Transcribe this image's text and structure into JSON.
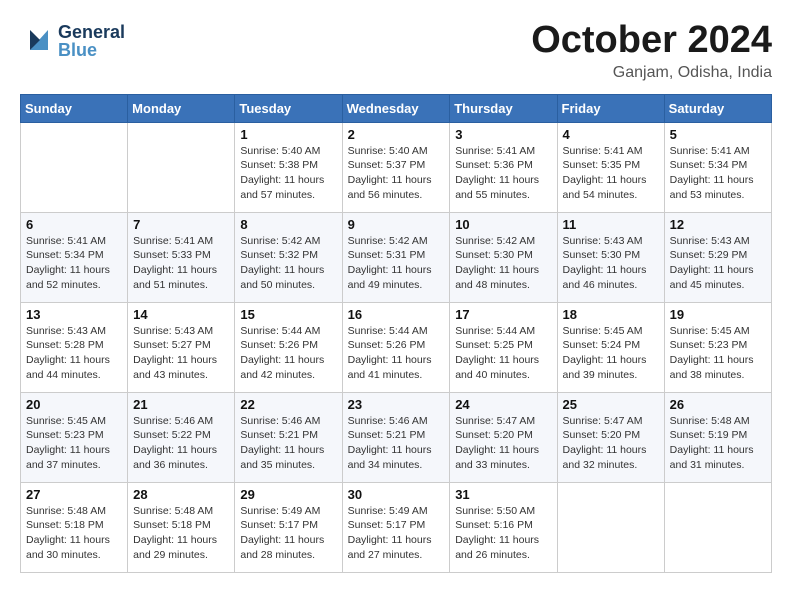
{
  "logo": {
    "general": "General",
    "blue": "Blue",
    "tagline": ""
  },
  "header": {
    "month": "October 2024",
    "location": "Ganjam, Odisha, India"
  },
  "weekdays": [
    "Sunday",
    "Monday",
    "Tuesday",
    "Wednesday",
    "Thursday",
    "Friday",
    "Saturday"
  ],
  "weeks": [
    [
      {
        "day": "",
        "info": ""
      },
      {
        "day": "",
        "info": ""
      },
      {
        "day": "1",
        "info": "Sunrise: 5:40 AM\nSunset: 5:38 PM\nDaylight: 11 hours\nand 57 minutes."
      },
      {
        "day": "2",
        "info": "Sunrise: 5:40 AM\nSunset: 5:37 PM\nDaylight: 11 hours\nand 56 minutes."
      },
      {
        "day": "3",
        "info": "Sunrise: 5:41 AM\nSunset: 5:36 PM\nDaylight: 11 hours\nand 55 minutes."
      },
      {
        "day": "4",
        "info": "Sunrise: 5:41 AM\nSunset: 5:35 PM\nDaylight: 11 hours\nand 54 minutes."
      },
      {
        "day": "5",
        "info": "Sunrise: 5:41 AM\nSunset: 5:34 PM\nDaylight: 11 hours\nand 53 minutes."
      }
    ],
    [
      {
        "day": "6",
        "info": "Sunrise: 5:41 AM\nSunset: 5:34 PM\nDaylight: 11 hours\nand 52 minutes."
      },
      {
        "day": "7",
        "info": "Sunrise: 5:41 AM\nSunset: 5:33 PM\nDaylight: 11 hours\nand 51 minutes."
      },
      {
        "day": "8",
        "info": "Sunrise: 5:42 AM\nSunset: 5:32 PM\nDaylight: 11 hours\nand 50 minutes."
      },
      {
        "day": "9",
        "info": "Sunrise: 5:42 AM\nSunset: 5:31 PM\nDaylight: 11 hours\nand 49 minutes."
      },
      {
        "day": "10",
        "info": "Sunrise: 5:42 AM\nSunset: 5:30 PM\nDaylight: 11 hours\nand 48 minutes."
      },
      {
        "day": "11",
        "info": "Sunrise: 5:43 AM\nSunset: 5:30 PM\nDaylight: 11 hours\nand 46 minutes."
      },
      {
        "day": "12",
        "info": "Sunrise: 5:43 AM\nSunset: 5:29 PM\nDaylight: 11 hours\nand 45 minutes."
      }
    ],
    [
      {
        "day": "13",
        "info": "Sunrise: 5:43 AM\nSunset: 5:28 PM\nDaylight: 11 hours\nand 44 minutes."
      },
      {
        "day": "14",
        "info": "Sunrise: 5:43 AM\nSunset: 5:27 PM\nDaylight: 11 hours\nand 43 minutes."
      },
      {
        "day": "15",
        "info": "Sunrise: 5:44 AM\nSunset: 5:26 PM\nDaylight: 11 hours\nand 42 minutes."
      },
      {
        "day": "16",
        "info": "Sunrise: 5:44 AM\nSunset: 5:26 PM\nDaylight: 11 hours\nand 41 minutes."
      },
      {
        "day": "17",
        "info": "Sunrise: 5:44 AM\nSunset: 5:25 PM\nDaylight: 11 hours\nand 40 minutes."
      },
      {
        "day": "18",
        "info": "Sunrise: 5:45 AM\nSunset: 5:24 PM\nDaylight: 11 hours\nand 39 minutes."
      },
      {
        "day": "19",
        "info": "Sunrise: 5:45 AM\nSunset: 5:23 PM\nDaylight: 11 hours\nand 38 minutes."
      }
    ],
    [
      {
        "day": "20",
        "info": "Sunrise: 5:45 AM\nSunset: 5:23 PM\nDaylight: 11 hours\nand 37 minutes."
      },
      {
        "day": "21",
        "info": "Sunrise: 5:46 AM\nSunset: 5:22 PM\nDaylight: 11 hours\nand 36 minutes."
      },
      {
        "day": "22",
        "info": "Sunrise: 5:46 AM\nSunset: 5:21 PM\nDaylight: 11 hours\nand 35 minutes."
      },
      {
        "day": "23",
        "info": "Sunrise: 5:46 AM\nSunset: 5:21 PM\nDaylight: 11 hours\nand 34 minutes."
      },
      {
        "day": "24",
        "info": "Sunrise: 5:47 AM\nSunset: 5:20 PM\nDaylight: 11 hours\nand 33 minutes."
      },
      {
        "day": "25",
        "info": "Sunrise: 5:47 AM\nSunset: 5:20 PM\nDaylight: 11 hours\nand 32 minutes."
      },
      {
        "day": "26",
        "info": "Sunrise: 5:48 AM\nSunset: 5:19 PM\nDaylight: 11 hours\nand 31 minutes."
      }
    ],
    [
      {
        "day": "27",
        "info": "Sunrise: 5:48 AM\nSunset: 5:18 PM\nDaylight: 11 hours\nand 30 minutes."
      },
      {
        "day": "28",
        "info": "Sunrise: 5:48 AM\nSunset: 5:18 PM\nDaylight: 11 hours\nand 29 minutes."
      },
      {
        "day": "29",
        "info": "Sunrise: 5:49 AM\nSunset: 5:17 PM\nDaylight: 11 hours\nand 28 minutes."
      },
      {
        "day": "30",
        "info": "Sunrise: 5:49 AM\nSunset: 5:17 PM\nDaylight: 11 hours\nand 27 minutes."
      },
      {
        "day": "31",
        "info": "Sunrise: 5:50 AM\nSunset: 5:16 PM\nDaylight: 11 hours\nand 26 minutes."
      },
      {
        "day": "",
        "info": ""
      },
      {
        "day": "",
        "info": ""
      }
    ]
  ]
}
